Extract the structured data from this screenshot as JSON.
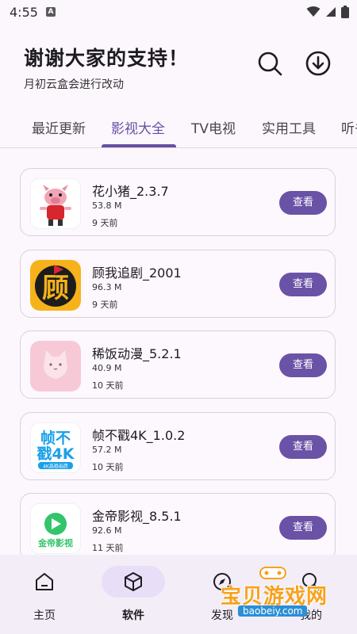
{
  "status_bar": {
    "time": "4:55",
    "notif_letter": "A"
  },
  "header": {
    "title": "谢谢大家的支持！",
    "subtitle": "月初云盒会进行改动",
    "search_icon": "search-icon",
    "download_icon": "download-icon"
  },
  "tabs": [
    {
      "label": "最近更新",
      "active": false
    },
    {
      "label": "影视大全",
      "active": true
    },
    {
      "label": "TV电视",
      "active": false
    },
    {
      "label": "实用工具",
      "active": false
    },
    {
      "label": "听书",
      "active": false
    }
  ],
  "apps": [
    {
      "name": "花小猪_2.3.7",
      "size": "53.8 M",
      "time": "9 天前",
      "button": "查看"
    },
    {
      "name": "顾我追剧_2001",
      "size": "96.3 M",
      "time": "9 天前",
      "button": "查看",
      "icon_char": "顾"
    },
    {
      "name": "稀饭动漫_5.2.1",
      "size": "40.9 M",
      "time": "10 天前",
      "button": "查看"
    },
    {
      "name": "帧不戳4K_1.0.2",
      "size": "57.2 M",
      "time": "10 天前",
      "button": "查看",
      "icon_line1": "帧不",
      "icon_line2": "戳4K",
      "icon_sub": "4K高稳画质"
    },
    {
      "name": "金帝影视_8.5.1",
      "size": "92.6 M",
      "time": "11 天前",
      "button": "查看",
      "icon_text": "金帝影视"
    }
  ],
  "bottom_nav": [
    {
      "label": "主页",
      "icon": "home-icon",
      "active": false
    },
    {
      "label": "软件",
      "icon": "package-icon",
      "active": true
    },
    {
      "label": "发现",
      "icon": "compass-icon",
      "active": false
    },
    {
      "label": "我的",
      "icon": "search-icon",
      "active": false
    }
  ],
  "watermark": {
    "title": "宝贝游戏网",
    "url": "baobeiy.com"
  },
  "colors": {
    "accent": "#6750a4",
    "button": "#6a52a6",
    "background": "#fcf7fd",
    "nav_background": "#f3edf7",
    "watermark": "#f7a21b"
  }
}
